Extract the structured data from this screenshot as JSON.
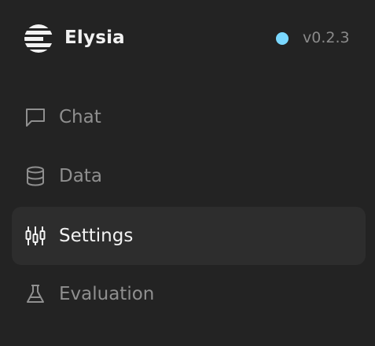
{
  "app": {
    "name": "Elysia",
    "version": "v0.2.3",
    "status_color": "#7ad8ff",
    "logo_icon": "elysia-logo-icon"
  },
  "nav": {
    "items": [
      {
        "label": "Chat",
        "icon": "chat-icon",
        "active": false
      },
      {
        "label": "Data",
        "icon": "database-icon",
        "active": false
      },
      {
        "label": "Settings",
        "icon": "sliders-icon",
        "active": true
      },
      {
        "label": "Evaluation",
        "icon": "flask-icon",
        "active": false
      }
    ]
  },
  "colors": {
    "background": "#232323",
    "active_item_bg": "#2d2d2d",
    "text_active": "#f2f2f2",
    "text_muted": "#8f8f8f"
  }
}
